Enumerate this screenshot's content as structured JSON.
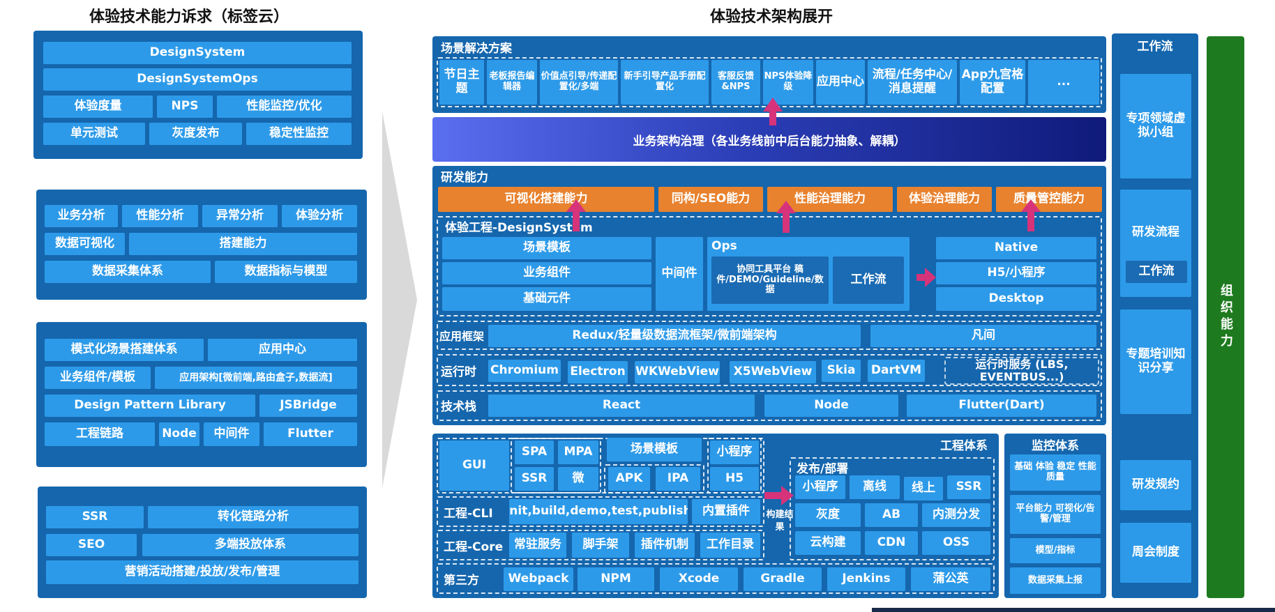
{
  "titles": {
    "left": "体验技术能力诉求（标签云）",
    "right": "体验技术架构展开"
  },
  "left_groups": {
    "g1": [
      "DesignSystem",
      "DesignSystemOps",
      "体验度量",
      "NPS",
      "性能监控/优化",
      "单元测试",
      "灰度发布",
      "稳定性监控"
    ],
    "g2": [
      "业务分析",
      "性能分析",
      "异常分析",
      "体验分析",
      "数据可视化",
      "搭建能力",
      "数据采集体系",
      "数据指标与模型"
    ],
    "g3": [
      "模式化场景搭建体系",
      "应用中心",
      "业务组件/模板",
      "应用架构[微前端,路由盒子,数据流]",
      "Design Pattern Library",
      "JSBridge",
      "工程链路",
      "Node",
      "中间件",
      "Flutter"
    ],
    "g4": [
      "SSR",
      "转化链路分析",
      "SEO",
      "多端投放体系",
      "营销活动搭建/投放/发布/管理"
    ]
  },
  "scene": {
    "title": "场景解决方案",
    "items": [
      "节日主题",
      "老板报告编辑器",
      "价值点引导/传递配置化/多端",
      "新手引导产品手册配置化",
      "客服反馈&NPS",
      "NPS体验降级",
      "应用中心",
      "流程/任务中心/消息提醒",
      "App九宫格配置",
      "..."
    ]
  },
  "governance": "业务架构治理（各业务线前中后台能力抽象、解耦）",
  "rd": {
    "title": "研发能力",
    "top": [
      "可视化搭建能力",
      "同构/SEO能力",
      "性能治理能力",
      "体验治理能力",
      "质量管控能力"
    ],
    "ds_title": "体验工程-DesignSystem",
    "ds_left": [
      "场景模板",
      "业务组件",
      "基础元件"
    ],
    "middleware": "中间件",
    "ops_title": "Ops",
    "ops_tool": "协同工具平台 稿件/DEMO/Guideline/数据",
    "ops_flow": "工作流",
    "targets": [
      "Native",
      "H5/小程序",
      "Desktop"
    ],
    "app_fw_label": "应用框架",
    "app_fw": [
      "Redux/轻量级数据流框架/微前端架构",
      "凡间"
    ],
    "runtime_label": "运行时",
    "runtime": [
      "Chromium",
      "Electron",
      "WKWebView",
      "X5WebView",
      "Skia",
      "DartVM"
    ],
    "runtime_service": "运行时服务 (LBS, EVENTBUS...)",
    "stack_label": "技术栈",
    "stack": [
      "React",
      "Node",
      "Flutter(Dart)"
    ]
  },
  "eng": {
    "title": "工程体系",
    "gui": "GUI",
    "gui_grid": [
      "SPA",
      "MPA",
      "SSR",
      "微"
    ],
    "scene_tpl": "场景模板",
    "apk": "APK",
    "ipa": "IPA",
    "mini": "小程序",
    "h5": "H5",
    "cli_label": "工程-CLI",
    "cli": "init,build,demo,test,publish",
    "cli_plugin": "内置插件",
    "core_label": "工程-Core",
    "core": [
      "常驻服务",
      "脚手架",
      "插件机制",
      "工作目录"
    ],
    "build_result": "构建结果",
    "deploy_title": "发布/部署",
    "deploy": [
      "小程序",
      "离线",
      "线上",
      "SSR",
      "灰度",
      "AB",
      "内测分发",
      "云构建",
      "CDN",
      "OSS"
    ],
    "third_label": "第三方",
    "third": [
      "Webpack",
      "NPM",
      "Xcode",
      "Gradle",
      "Jenkins",
      "蒲公英"
    ]
  },
  "monitor": {
    "title": "监控体系",
    "items": [
      "基础 体验 稳定 性能 质量",
      "平台能力 可视化/告警/管理",
      "模型/指标",
      "数据采集上报"
    ]
  },
  "workflow": {
    "title": "工作流",
    "items": [
      "专项领域虚拟小组",
      "研发流程",
      "工作流",
      "专题培训知识分享",
      "研发规约",
      "周会制度"
    ]
  },
  "org": "组织能力",
  "colors": {
    "panel": "#1566ad",
    "box": "#2d9ae9",
    "orange": "#e8822e",
    "green": "#1e7a1e",
    "arrow": "#d6337a"
  }
}
